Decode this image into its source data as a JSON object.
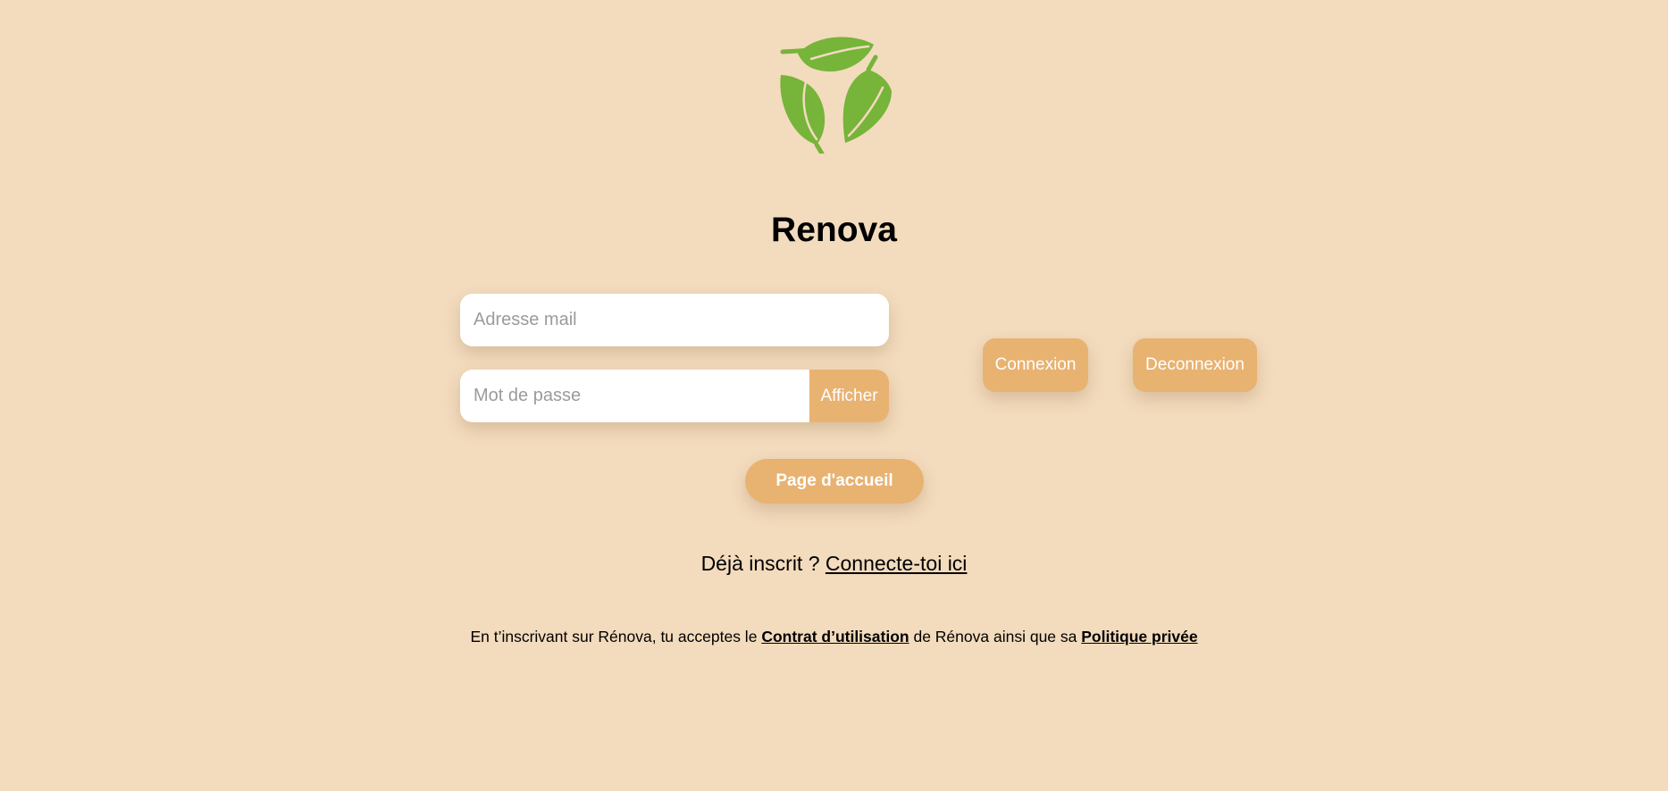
{
  "app": {
    "title": "Renova"
  },
  "form": {
    "email_placeholder": "Adresse mail",
    "password_placeholder": "Mot de passe",
    "show_password_label": "Afficher"
  },
  "actions": {
    "connect_label": "Connexion",
    "disconnect_label": "Deconnexion",
    "home_label": "Page d'accueil"
  },
  "signin_prompt": {
    "text": "Déjà inscrit ?",
    "link": "Connecte-toi ici"
  },
  "terms": {
    "prefix": "En t’inscrivant sur Rénova, tu acceptes le",
    "contract_link": "Contrat d’utilisation",
    "middle": "de Rénova ainsi que sa",
    "privacy_link": "Politique privée"
  },
  "icons": {
    "logo": "recycle-leaves-logo"
  },
  "colors": {
    "background": "#f3dbbd",
    "accent": "#e8b271",
    "logo_green": "#76b43a"
  }
}
